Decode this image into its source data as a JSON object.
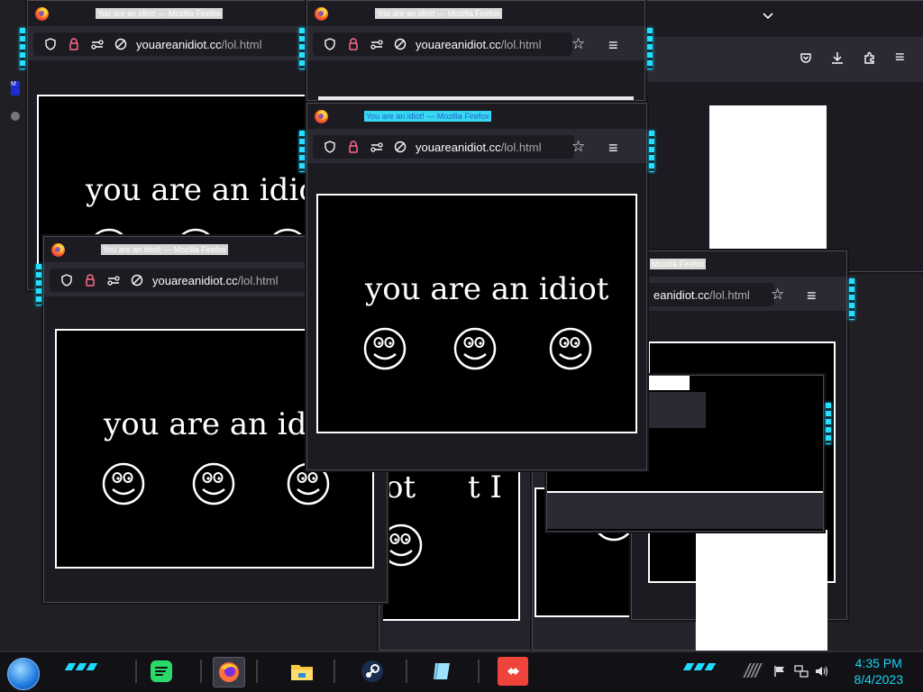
{
  "window": {
    "title": "You are an idiot! — Mozilla Firefox",
    "url_host": "youareanidiot.cc",
    "url_path": "/lol.html",
    "url_host_partial": "eanidiot.cc",
    "page_text": "you are an idiot",
    "page_text_cut1": "you are an idio",
    "page_text_cut2": "you are an idi",
    "page_text_cut3": "ot",
    "page_text_cut4": "t I"
  },
  "back_browser": {
    "title_partial": "Mozilla Firefox"
  },
  "taskbar": {
    "clock_time": "4:35 PM",
    "clock_date": "8/4/2023",
    "apps": [
      {
        "name": "spotify",
        "label": "Spotify"
      },
      {
        "name": "firefox",
        "label": "Firefox"
      },
      {
        "name": "file-explorer",
        "label": "File Explorer"
      },
      {
        "name": "steam",
        "label": "Steam"
      },
      {
        "name": "notebook",
        "label": "Notebook"
      },
      {
        "name": "anydesk",
        "label": "AnyDesk"
      }
    ]
  },
  "colors": {
    "accent_cyan": "#1fd9ff",
    "firefox_bg": "#2b2a33",
    "urlbar_bg": "#1c1b22",
    "page_bg": "#000000"
  }
}
